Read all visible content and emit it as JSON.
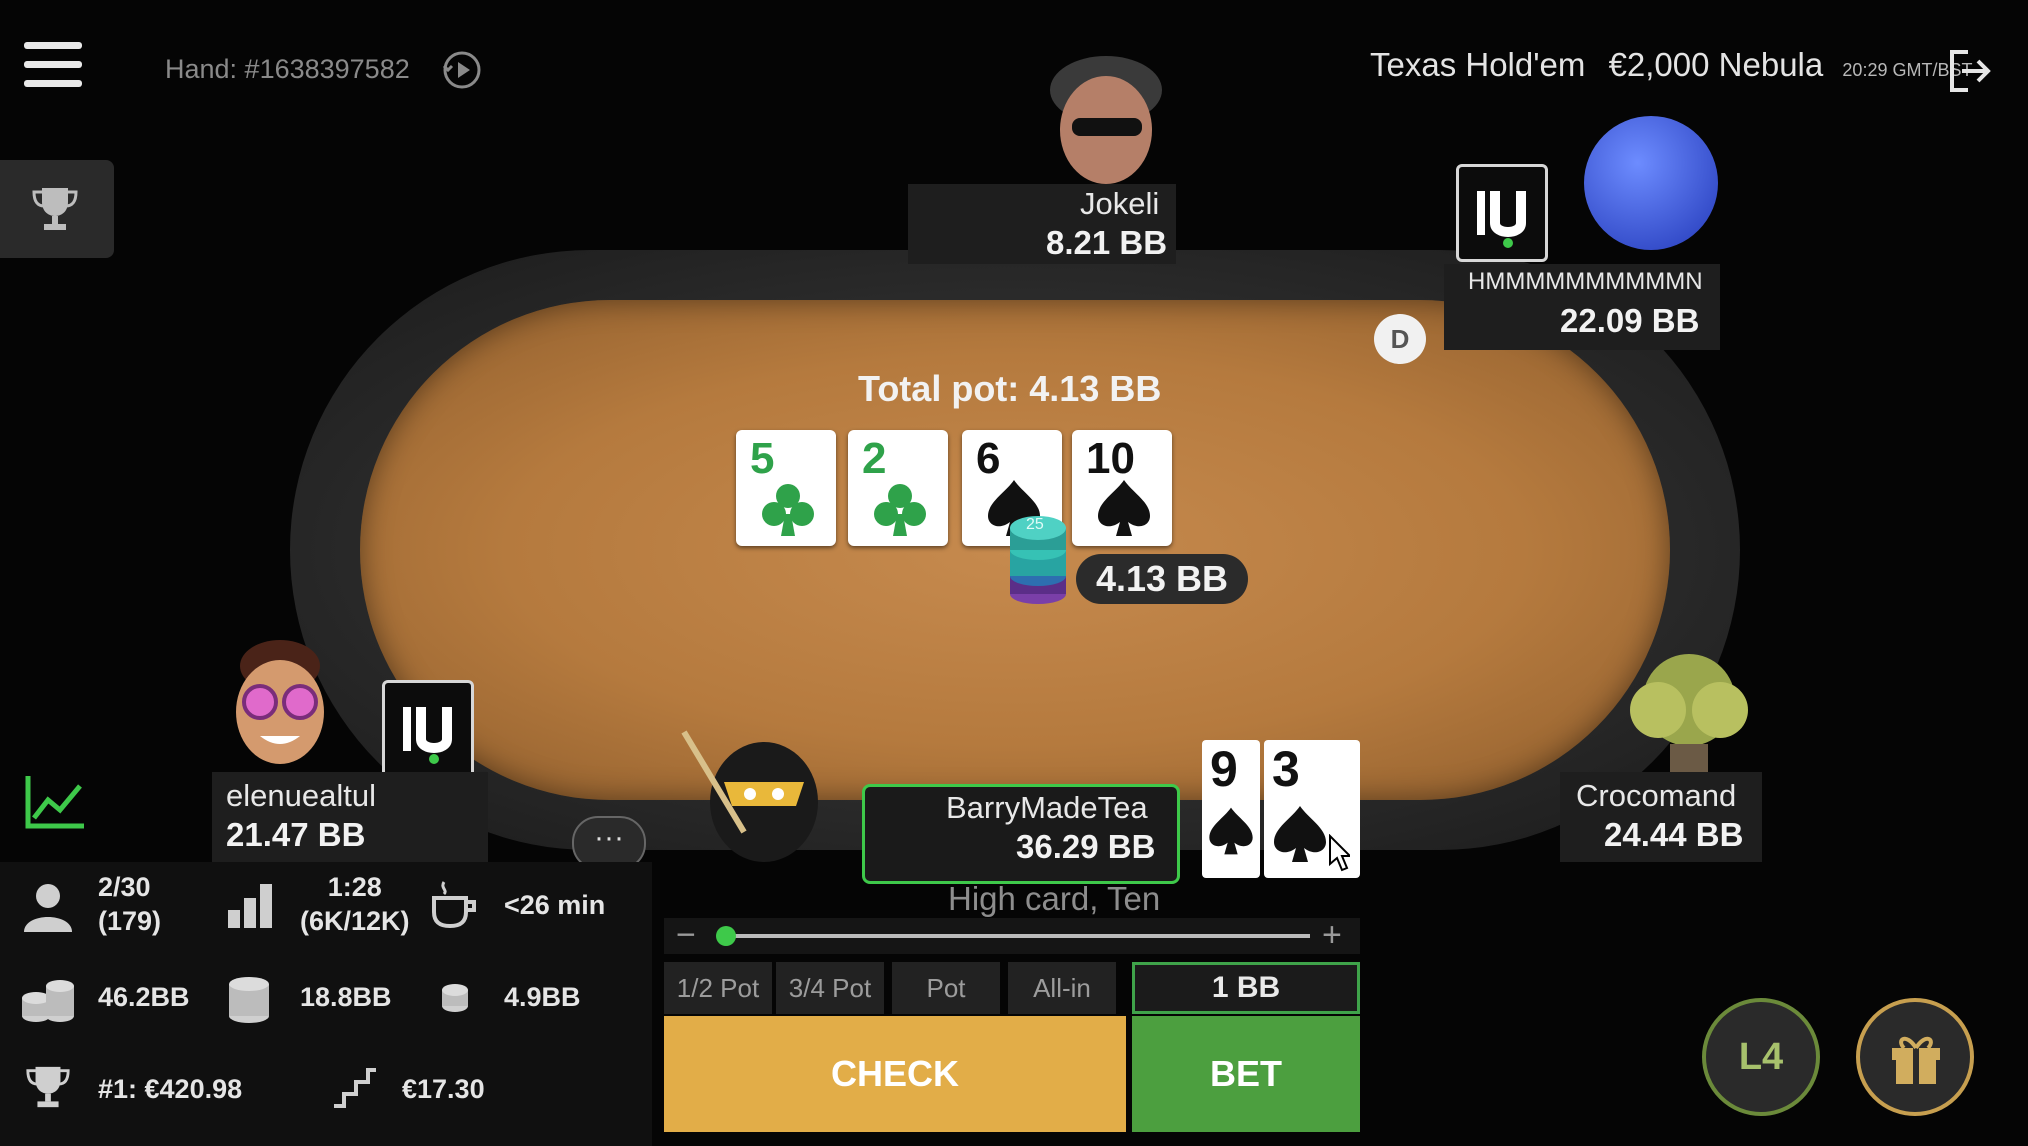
{
  "header": {
    "hand_id": "Hand: #1638397582",
    "game_type": "Texas Hold'em",
    "table_name": "€2,000 Nebula",
    "time": "20:29 GMT/BST"
  },
  "pot": {
    "total_label": "Total pot: 4.13 BB",
    "amount": "4.13 BB",
    "chip_value": "25"
  },
  "board": [
    {
      "rank": "5",
      "suit": "clubs"
    },
    {
      "rank": "2",
      "suit": "clubs"
    },
    {
      "rank": "6",
      "suit": "spades"
    },
    {
      "rank": "10",
      "suit": "spades"
    }
  ],
  "dealer_button": "D",
  "players": {
    "top": {
      "name": "Jokeli",
      "stack": "8.21 BB"
    },
    "top_right": {
      "name": "HMMMMMMMMMMN",
      "stack": "22.09 BB"
    },
    "left": {
      "name": "elenuealtul",
      "stack": "21.47 BB"
    },
    "right": {
      "name": "Crocomand",
      "stack": "24.44 BB"
    },
    "hero": {
      "name": "BarryMadeTea",
      "stack": "36.29 BB",
      "hand_desc": "High card, Ten",
      "cards": [
        {
          "rank": "9",
          "suit": "spades"
        },
        {
          "rank": "3",
          "suit": "spades"
        }
      ]
    }
  },
  "chat_label": "···",
  "bet_controls": {
    "minus": "−",
    "plus": "+",
    "slider_fraction": 0.0,
    "presets": [
      "1/2 Pot",
      "3/4 Pot",
      "Pot",
      "All-in"
    ],
    "bet_amount": "1 BB",
    "check_label": "CHECK",
    "bet_label": "BET"
  },
  "stats": {
    "position": "2/30",
    "position_total": "(179)",
    "blinds": "1:28",
    "blinds_levels": "(6K/12K)",
    "break_time": "<26 min",
    "avg_stack": "46.2BB",
    "my_stack": "18.8BB",
    "min_stack": "4.9BB",
    "first_prize": "#1: €420.98",
    "next_payout": "€17.30"
  },
  "level_badge": "L4",
  "colors": {
    "accent_green": "#3ec94a",
    "check_yellow": "#e2ad48",
    "bet_green": "#4c9f3f",
    "felt": "#b57a3e"
  }
}
